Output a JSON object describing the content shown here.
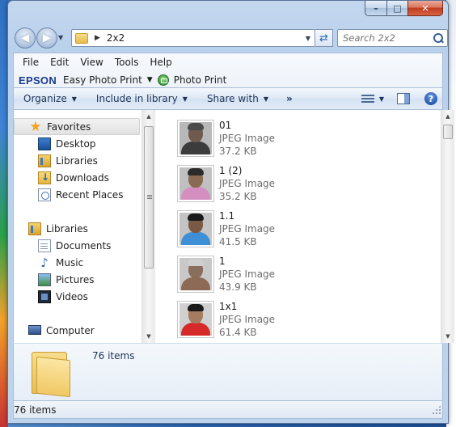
{
  "window": {
    "caption_buttons": {
      "minimize": "–",
      "maximize": "□",
      "close": "✕"
    }
  },
  "nav": {
    "back_glyph": "◀",
    "forward_glyph": "▶",
    "address_segment": "2x2",
    "search_placeholder": "Search 2x2"
  },
  "menu": {
    "items": [
      "File",
      "Edit",
      "View",
      "Tools",
      "Help"
    ]
  },
  "epson": {
    "logo": "EPSON",
    "easy_photo_print": "Easy Photo Print",
    "photo_print": "Photo Print"
  },
  "commands": {
    "organize": "Organize",
    "include_in_library": "Include in library",
    "share_with": "Share with",
    "more": "»",
    "help_glyph": "?"
  },
  "sidebar": {
    "items": [
      {
        "label": "Favorites",
        "icon": "star-icon",
        "indent": false
      },
      {
        "label": "Desktop",
        "icon": "desktop-icon",
        "indent": true
      },
      {
        "label": "Libraries",
        "icon": "libraries-icon",
        "indent": true
      },
      {
        "label": "Downloads",
        "icon": "downloads-icon",
        "indent": true
      },
      {
        "label": "Recent Places",
        "icon": "recent-places-icon",
        "indent": true
      },
      {
        "label": "Libraries",
        "icon": "libraries-icon",
        "indent": false
      },
      {
        "label": "Documents",
        "icon": "documents-icon",
        "indent": true
      },
      {
        "label": "Music",
        "icon": "music-icon",
        "indent": true
      },
      {
        "label": "Pictures",
        "icon": "pictures-icon",
        "indent": true
      },
      {
        "label": "Videos",
        "icon": "videos-icon",
        "indent": true
      },
      {
        "label": "Computer",
        "icon": "computer-icon",
        "indent": false
      }
    ]
  },
  "files": [
    {
      "name": "01",
      "type": "JPEG Image",
      "size": "37.2 KB",
      "bg": "#b8b8b8",
      "shirt": "#3c3c3c",
      "hair": "#4a4a4a",
      "skin": "#6e5a4e"
    },
    {
      "name": "1 (2)",
      "type": "JPEG Image",
      "size": "35.2 KB",
      "bg": "#c0c0c0",
      "shirt": "#d48fc0",
      "hair": "#2a2a2a",
      "skin": "#8a6a52"
    },
    {
      "name": "1.1",
      "type": "JPEG Image",
      "size": "41.5 KB",
      "bg": "#c4c4c4",
      "shirt": "#3f8fd6",
      "hair": "#1a1a1a",
      "skin": "#7a5a44"
    },
    {
      "name": "1",
      "type": "JPEG Image",
      "size": "43.9 KB",
      "bg": "#c8c8c8",
      "shirt": "#8c6a56",
      "hair": "#cfcfcf",
      "skin": "#8a6e5c"
    },
    {
      "name": "1x1",
      "type": "JPEG Image",
      "size": "61.4 KB",
      "bg": "#d0d0d0",
      "shirt": "#d62a2a",
      "hair": "#1a1a1a",
      "skin": "#a57c60"
    }
  ],
  "details": {
    "item_count": "76 items"
  },
  "status": {
    "text": "76 items"
  }
}
